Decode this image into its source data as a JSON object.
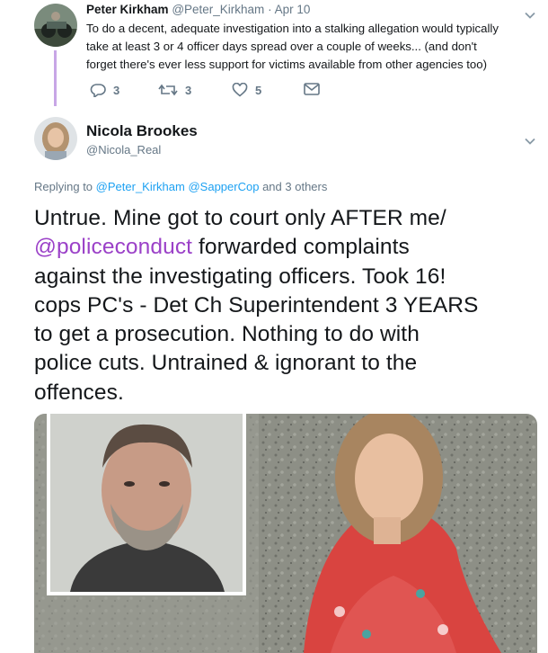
{
  "reply_tweet": {
    "author_name": "Peter Kirkham",
    "author_handle": "@Peter_Kirkham",
    "separator": "·",
    "date": "Apr 10",
    "text_lines": [
      "To do a decent, adequate investigation into a stalking allegation would typically",
      "take at least 3 or 4 officer days spread over a couple of weeks... (and don't",
      "forget there's ever less support for victims available from other agencies too)"
    ],
    "actions": {
      "replies": "3",
      "retweets": "3",
      "likes": "5"
    }
  },
  "main_tweet": {
    "author_name": "Nicola Brookes",
    "author_handle": "@Nicola_Real",
    "replying_prefix": "Replying to",
    "replying_handle_1": "@Peter_Kirkham",
    "replying_handle_2": "@SapperCop",
    "replying_suffix": "and 3 others",
    "text_line_1": "Untrue. Mine got to court only AFTER me/",
    "text_mention": "@policeconduct",
    "text_line_2_rest": " forwarded complaints",
    "text_lines_rest": [
      "against the investigating officers. Took 16!",
      "cops PC's - Det Ch Superintendent 3 YEARS",
      "to get a prosecution. Nothing to do with",
      "police cuts. Untrained & ignorant to the",
      "offences."
    ]
  },
  "colors": {
    "link": "#1da1f2",
    "mention": "#9b41c8",
    "thread_line": "#c8a6e6",
    "muted": "#657786"
  }
}
